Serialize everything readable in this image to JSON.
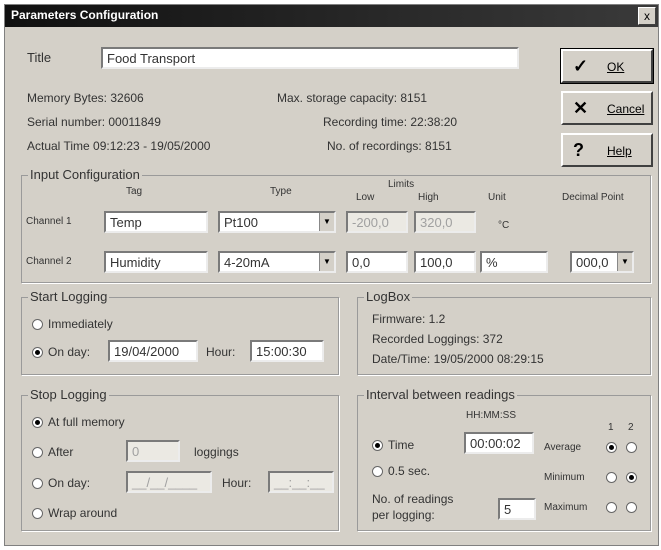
{
  "window": {
    "title": "Parameters Configuration",
    "close": "x"
  },
  "header": {
    "title_label": "Title",
    "title_value": "Food Transport",
    "memory": "Memory Bytes: 32606",
    "serial": "Serial number: 00011849",
    "actual_time": "Actual Time   09:12:23 - 19/05/2000",
    "max_storage": "Max. storage capacity: 8151",
    "recording_time": "Recording time: 22:38:20",
    "num_recordings": "No. of recordings: 8151"
  },
  "buttons": {
    "ok": "OK",
    "cancel": "Cancel",
    "help": "Help"
  },
  "input_config": {
    "title": "Input Configuration",
    "headers": {
      "tag": "Tag",
      "type": "Type",
      "limits": "Limits",
      "low": "Low",
      "high": "High",
      "unit": "Unit",
      "decimal": "Decimal Point"
    },
    "channel1": {
      "label": "Channel 1",
      "tag": "Temp",
      "type": "Pt100",
      "low": "-200,0",
      "high": "320,0",
      "unit": "°C"
    },
    "channel2": {
      "label": "Channel 2",
      "tag": "Humidity",
      "type": "4-20mA",
      "low": "0,0",
      "high": "100,0",
      "unit": "%",
      "decimal": "000,0"
    }
  },
  "start_logging": {
    "title": "Start Logging",
    "immediately": "Immediately",
    "on_day": "On day:",
    "date": "19/04/2000",
    "hour_label": "Hour:",
    "hour": "15:00:30"
  },
  "logbox": {
    "title": "LogBox",
    "firmware": "Firmware: 1.2",
    "recorded": "Recorded Loggings: 372",
    "datetime": "Date/Time: 19/05/2000  08:29:15"
  },
  "stop_logging": {
    "title": "Stop Logging",
    "at_full": "At full memory",
    "after": "After",
    "after_value": "0",
    "loggings": "loggings",
    "on_day": "On day:",
    "date": "__/__/____",
    "hour_label": "Hour:",
    "hour": "__:__:__",
    "wrap": "Wrap around"
  },
  "interval": {
    "title": "Interval between readings",
    "format": "HH:MM:SS",
    "time": "Time",
    "time_value": "00:00:02",
    "half_sec": "0.5 sec.",
    "readings_label_1": "No. of readings",
    "readings_label_2": "per logging:",
    "readings_value": "5",
    "col1": "1",
    "col2": "2",
    "average": "Average",
    "minimum": "Minimum",
    "maximum": "Maximum"
  }
}
